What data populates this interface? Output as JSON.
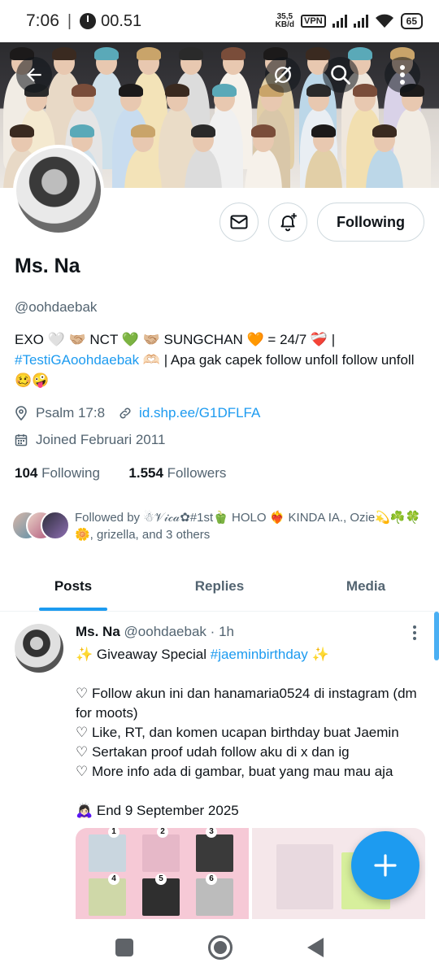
{
  "status_bar": {
    "time": "7:06",
    "separator": "|",
    "timer": "00.51",
    "net_speed_value": "35,5",
    "net_speed_unit": "KB/d",
    "vpn": "VPN",
    "battery": "65"
  },
  "profile": {
    "name": "Ms. Na",
    "handle": "@oohdaebak",
    "following_button": "Following",
    "bio_line1": "EXO 🤍 🤝🏼 NCT 💚 🤝🏼 SUNGCHAN 🧡 = 24/7 ❤️‍🩹 |",
    "bio_hashtag": "#TestiGAoohdaebak",
    "bio_line2_rest": " 🫶🏻 | Apa gak capek follow unfoll follow unfoll 🥴🤪",
    "location": "Psalm 17:8",
    "website": "id.shp.ee/G1DFLFA",
    "joined": "Joined Februari 2011",
    "following_count": "104",
    "following_label": "Following",
    "followers_count": "1.554",
    "followers_label": "Followers",
    "followed_by": "Followed by ☃𝒱𝒾𝒸𝒶✿#1st🫑 HOLO ❤️‍🔥 KINDA IA., Ozie💫☘️🍀🌼, grizella, and 3 others"
  },
  "tabs": [
    {
      "label": "Posts",
      "active": true
    },
    {
      "label": "Replies",
      "active": false
    },
    {
      "label": "Media",
      "active": false
    }
  ],
  "post": {
    "author": "Ms. Na",
    "handle": "@oohdaebak",
    "dot": "·",
    "time": "1h",
    "line1_prefix": "✨ Giveaway Special ",
    "line1_hashtag": "#jaeminbirthday",
    "line1_suffix": " ✨",
    "lines": [
      "♡ Follow akun ini dan hanamaria0524 di instagram (dm for moots)",
      "♡ Like, RT, dan komen ucapan birthday buat Jaemin",
      "♡ Sertakan proof udah follow aku di x dan ig",
      "♡ More info ada di gambar, buat yang mau mau aja"
    ],
    "end_line": "🙇🏻‍♀️ End 9 September 2025",
    "media_numbers": [
      "1",
      "2",
      "3",
      "4",
      "5",
      "6"
    ]
  },
  "icons": {
    "back": "arrow-left-icon",
    "grok": "grok-icon",
    "search": "search-icon",
    "more": "more-vertical-icon",
    "message": "envelope-icon",
    "notify": "bell-plus-icon",
    "location": "location-pin-icon",
    "link": "link-icon",
    "calendar": "calendar-icon",
    "compose": "plus-icon"
  },
  "colors": {
    "accent": "#1d9bf0",
    "text": "#0f1419",
    "secondary": "#536471",
    "border": "#cfd9de"
  }
}
